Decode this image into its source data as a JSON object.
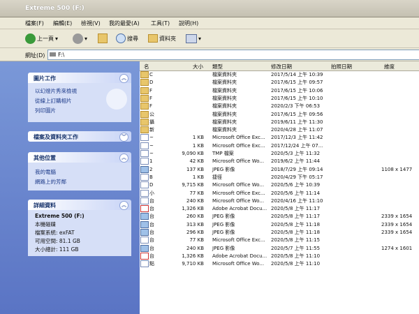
{
  "window": {
    "title": "Extreme 500 (F:)"
  },
  "menu": [
    "檔案(F)",
    "編輯(E)",
    "檢視(V)",
    "我的最愛(A)",
    "工具(T)",
    "說明(H)"
  ],
  "toolbar": {
    "back": "上一頁",
    "search": "搜尋",
    "folders": "資料夾"
  },
  "address": {
    "label": "網址(D)",
    "value": "F:\\"
  },
  "left": {
    "picture_tasks": {
      "title": "圖片工作",
      "items": [
        "以幻燈片秀來檢視",
        "從線上訂購相片",
        "列印圖片"
      ]
    },
    "file_folder_tasks": {
      "title": "檔案及資料夾工作"
    },
    "other_places": {
      "title": "其他位置",
      "items": [
        "我的電腦",
        "網路上的芳鄰"
      ]
    },
    "details": {
      "title": "詳細資料",
      "name": "Extreme 500 (F:)",
      "type": "本機磁碟",
      "fs": "檔案系統: exFAT",
      "free": "可用空間: 81.1 GB",
      "total": "大小總計: 111 GB"
    }
  },
  "columns": {
    "name": "名",
    "size": "大小",
    "type": "類型",
    "modified": "修改日期",
    "taken": "拍照日期",
    "dims": "維度"
  },
  "rows": [
    {
      "icon": "folder",
      "name": "C",
      "size": "",
      "type": "檔案資料夾",
      "date": "2017/5/14 上午 10:39",
      "dims": ""
    },
    {
      "icon": "folder",
      "name": "D",
      "size": "",
      "type": "檔案資料夾",
      "date": "2017/6/15 上午 09:57",
      "dims": ""
    },
    {
      "icon": "folder",
      "name": "F",
      "size": "",
      "type": "檔案資料夾",
      "date": "2017/6/15 上午 10:06",
      "dims": ""
    },
    {
      "icon": "folder",
      "name": "F",
      "size": "",
      "type": "檔案資料夾",
      "date": "2017/6/15 上午 10:10",
      "dims": ""
    },
    {
      "icon": "folder",
      "name": "F",
      "size": "",
      "type": "檔案資料夾",
      "date": "2020/2/3 下午 06:53",
      "dims": ""
    },
    {
      "icon": "folder",
      "name": "公",
      "size": "",
      "type": "檔案資料夾",
      "date": "2017/6/15 上午 09:56",
      "dims": ""
    },
    {
      "icon": "folder",
      "name": "攝",
      "size": "",
      "type": "檔案資料夾",
      "date": "2019/6/11 上午 11:30",
      "dims": ""
    },
    {
      "icon": "folder",
      "name": "新",
      "size": "",
      "type": "檔案資料夾",
      "date": "2020/4/28 上午 11:07",
      "dims": ""
    },
    {
      "icon": "doc",
      "name": "~",
      "size": "1 KB",
      "type": "Microsoft Office Exc...",
      "date": "2017/12/3 上午 11:42",
      "dims": ""
    },
    {
      "icon": "doc",
      "name": "~",
      "size": "1 KB",
      "type": "Microsoft Office Exc...",
      "date": "2017/12/24 上午 07...",
      "dims": ""
    },
    {
      "icon": "doc",
      "name": "~",
      "size": "9,090 KB",
      "type": "TMP 檔案",
      "date": "2020/5/3 上午 11:32",
      "dims": ""
    },
    {
      "icon": "doc",
      "name": "1",
      "size": "42 KB",
      "type": "Microsoft Office Wo...",
      "date": "2019/6/2 上午 11:44",
      "dims": ""
    },
    {
      "icon": "img",
      "name": "2",
      "size": "137 KB",
      "type": "JPEG 影像",
      "date": "2018/7/29 上午 09:14",
      "dims": "1108 x 1477"
    },
    {
      "icon": "doc",
      "name": "B",
      "size": "1 KB",
      "type": "捷徑",
      "date": "2020/4/29 下午 05:17",
      "dims": ""
    },
    {
      "icon": "doc",
      "name": "D",
      "size": "9,715 KB",
      "type": "Microsoft Office Wo...",
      "date": "2020/5/6 上午 10:39",
      "dims": ""
    },
    {
      "icon": "doc",
      "name": "小",
      "size": "77 KB",
      "type": "Microsoft Office Exc...",
      "date": "2020/5/6 上午 11:14",
      "dims": ""
    },
    {
      "icon": "doc",
      "name": "台",
      "size": "240 KB",
      "type": "Microsoft Office Wo...",
      "date": "2020/4/16 上午 11:10",
      "dims": ""
    },
    {
      "icon": "pdf",
      "name": "台",
      "size": "1,326 KB",
      "type": "Adobe Acrobat Docu...",
      "date": "2020/5/8 上午 11:17",
      "dims": ""
    },
    {
      "icon": "img",
      "name": "台",
      "size": "260 KB",
      "type": "JPEG 影像",
      "date": "2020/5/8 上午 11:17",
      "dims": "2339 x 1654"
    },
    {
      "icon": "img",
      "name": "台",
      "size": "313 KB",
      "type": "JPEG 影像",
      "date": "2020/5/8 上午 11:18",
      "dims": "2339 x 1654"
    },
    {
      "icon": "img",
      "name": "台",
      "size": "296 KB",
      "type": "JPEG 影像",
      "date": "2020/5/8 上午 11:18",
      "dims": "2339 x 1654"
    },
    {
      "icon": "doc",
      "name": "台",
      "size": "77 KB",
      "type": "Microsoft Office Exc...",
      "date": "2020/5/8 上午 11:15",
      "dims": ""
    },
    {
      "icon": "img",
      "name": "台",
      "size": "240 KB",
      "type": "JPEG 影像",
      "date": "2020/5/7 上午 11:55",
      "dims": "1274 x 1601"
    },
    {
      "icon": "pdf",
      "name": "台",
      "size": "1,326 KB",
      "type": "Adobe Acrobat Docu...",
      "date": "2020/5/8 上午 11:10",
      "dims": ""
    },
    {
      "icon": "doc",
      "name": "點",
      "size": "9,710 KB",
      "type": "Microsoft Office Wo...",
      "date": "2020/5/8 上午 11:10",
      "dims": ""
    }
  ]
}
